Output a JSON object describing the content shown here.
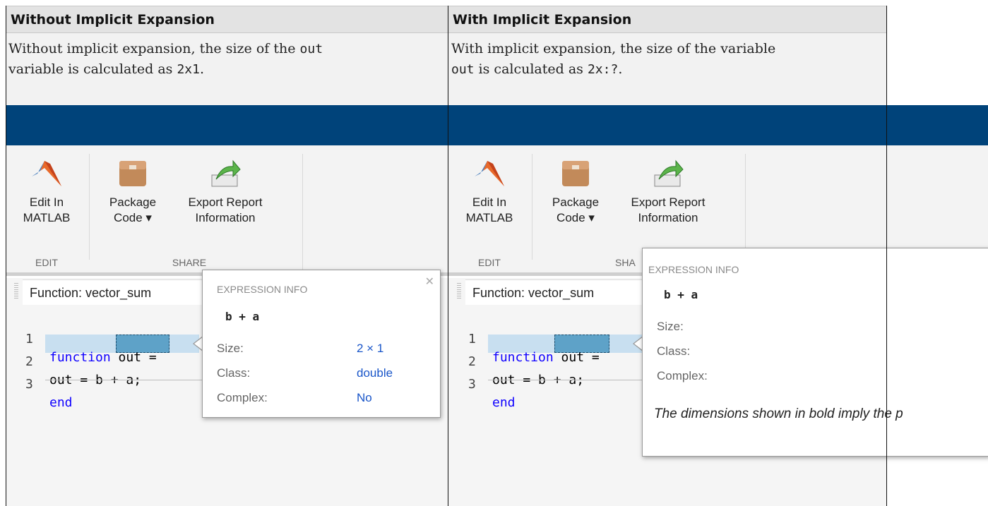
{
  "table": {
    "header_left": "Without Implicit Expansion",
    "header_right": "With Implicit Expansion",
    "desc_left": {
      "p1": "Without implicit expansion, the size of the ",
      "code1": "out",
      "p2": "variable is calculated as ",
      "code2": "2x1",
      "p3": "."
    },
    "desc_right": {
      "p1": "With implicit expansion, the size of the variable",
      "code1": "out",
      "p2": " is calculated as ",
      "code2": "2x:?",
      "p3": "."
    }
  },
  "toolstrip": {
    "edit_in_matlab_1": "Edit In",
    "edit_in_matlab_2": "MATLAB",
    "package_code_1": "Package",
    "package_code_2": "Code ▾",
    "export_report_1": "Export Report",
    "export_report_2": "Information",
    "group_edit": "EDIT",
    "group_share": "SHARE",
    "group_share_partial": "SHA"
  },
  "editor": {
    "tab_label": "Function: vector_sum",
    "line_numbers": [
      "1",
      "2",
      "3"
    ],
    "line1_kw": "function",
    "line1_rest": " out =",
    "line2_pre": "out = ",
    "line2_sel": "b + a",
    "line2_post": ";",
    "line3_kw": "end"
  },
  "popup_left": {
    "title": "EXPRESSION INFO",
    "expression": "b + a",
    "size_label": "Size:",
    "size_value": "2 × 1",
    "class_label": "Class:",
    "class_value": "double",
    "complex_label": "Complex:",
    "complex_value": "No",
    "close": "✕"
  },
  "popup_right": {
    "title": "EXPRESSION INFO",
    "expression": "b + a",
    "size_label": "Size:",
    "class_label": "Class:",
    "complex_label": "Complex:",
    "note": "The dimensions shown in bold imply the p"
  },
  "colors": {
    "banner": "#00437a",
    "header_bg": "#e3e3e3",
    "keyword": "#0e00ff",
    "selection": "#5ea2c8",
    "line_highlight": "#c8dff0",
    "popup_value": "#1a56c9"
  }
}
